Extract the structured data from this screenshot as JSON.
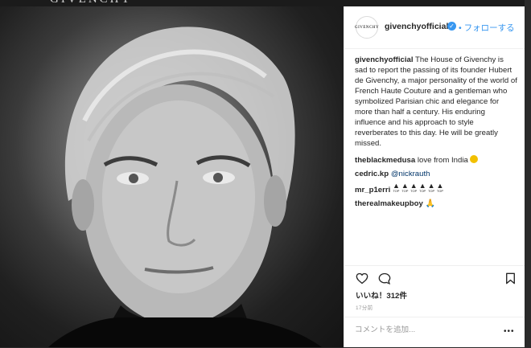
{
  "brand": "GIVENCHY",
  "post": {
    "username": "givenchyofficial",
    "follow_label": "• フォローする",
    "avatar_text": "GIVENCHY",
    "caption_user": "givenchyofficial",
    "caption_text": "The House of Givenchy is sad to report the passing of its founder Hubert de Givenchy, a major personality of the world of French Haute Couture and a gentleman who symbolized Parisian chic and elegance for more than half a century. His enduring influence and his approach to style reverberates to this day. He will be greatly missed.",
    "comments": [
      {
        "user": "theblackmedusa",
        "text": "love from India"
      },
      {
        "user": "cedric.kp",
        "text": "@nickrauth"
      },
      {
        "user": "mr_p1erri",
        "text": ""
      },
      {
        "user": "therealmakeupboy",
        "text": ""
      }
    ],
    "top_emoji_label": "TOP",
    "likes": "いいね！312件",
    "time": "17分前",
    "comment_placeholder": "コメントを追加...",
    "more_label": "•••"
  },
  "icons": {
    "like": "heart-icon",
    "comment": "comment-bubble-icon",
    "save": "bookmark-icon",
    "verified": "verified-badge-icon"
  },
  "colors": {
    "accent": "#3897f0",
    "text": "#262626",
    "muted": "#999999"
  }
}
